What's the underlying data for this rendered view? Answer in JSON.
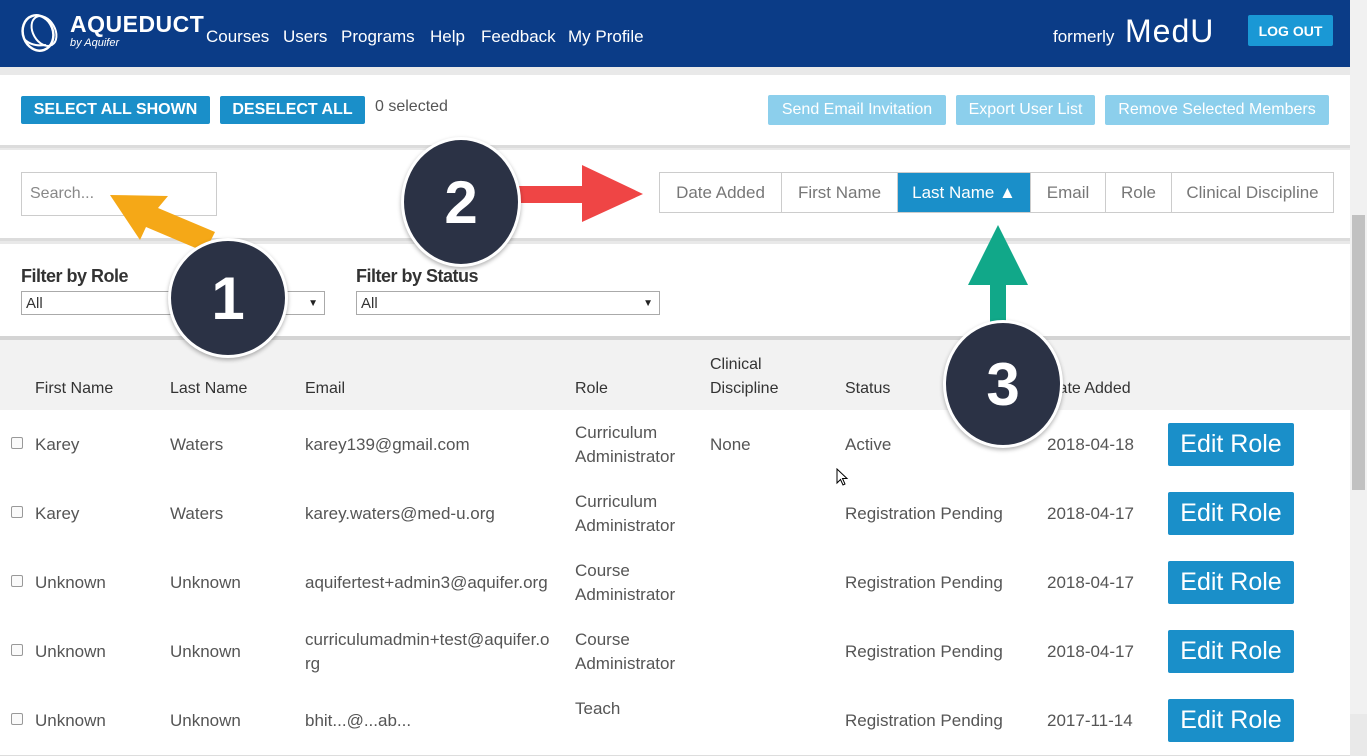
{
  "header": {
    "logo_title": "AQUEDUCT",
    "logo_subtitle": "by Aquifer",
    "nav": [
      "Courses",
      "Users",
      "Programs",
      "Help",
      "Feedback",
      "My Profile"
    ],
    "formerly": "formerly",
    "brand": "MedU",
    "logout": "LOG OUT",
    "bg_color": "#0b3c87"
  },
  "actions": {
    "select_all": "SELECT ALL SHOWN",
    "deselect_all": "DESELECT ALL",
    "selected_count": "0 selected",
    "send_invite": "Send Email Invitation",
    "export": "Export User List",
    "remove": "Remove Selected Members"
  },
  "search": {
    "placeholder": "Search..."
  },
  "sort": {
    "options": [
      "Date Added",
      "First Name",
      "Last Name ▲",
      "Email",
      "Role",
      "Clinical Discipline"
    ],
    "active": "Last Name ▲"
  },
  "filters": {
    "role_label": "Filter by Role",
    "role_value": "All",
    "status_label": "Filter by Status",
    "status_value": "All"
  },
  "table": {
    "headers": {
      "first_name": "First Name",
      "last_name": "Last Name",
      "email": "Email",
      "role": "Role",
      "clinical_1": "Clinical",
      "clinical_2": "Discipline",
      "status": "Status",
      "date_added": "Date Added"
    },
    "rows": [
      {
        "first": "Karey",
        "last": "Waters",
        "email": "karey139@gmail.com",
        "email2": "",
        "role1": "Curriculum",
        "role2": "Administrator",
        "discipline": "None",
        "status": "Active",
        "date": "2018-04-18",
        "action": "Edit Role"
      },
      {
        "first": "Karey",
        "last": "Waters",
        "email": "karey.waters@med-u.org",
        "email2": "",
        "role1": "Curriculum",
        "role2": "Administrator",
        "discipline": "",
        "status": "Registration Pending",
        "date": "2018-04-17",
        "action": "Edit Role"
      },
      {
        "first": "Unknown",
        "last": "Unknown",
        "email": "aquifertest+admin3@aquifer.org",
        "email2": "",
        "role1": "Course",
        "role2": "Administrator",
        "discipline": "",
        "status": "Registration Pending",
        "date": "2018-04-17",
        "action": "Edit Role"
      },
      {
        "first": "Unknown",
        "last": "Unknown",
        "email": "curriculumadmin+test@aquifer.o",
        "email2": "rg",
        "role1": "Course",
        "role2": "Administrator",
        "discipline": "",
        "status": "Registration Pending",
        "date": "2018-04-17",
        "action": "Edit Role"
      },
      {
        "first": "Unknown",
        "last": "Unknown",
        "email": "bhit...@...ab...",
        "email2": "",
        "role1": "Teach",
        "role2": "",
        "discipline": "",
        "status": "Registration Pending",
        "date": "2017-11-14",
        "action": "Edit Role"
      }
    ]
  },
  "annotations": {
    "badges": [
      "1",
      "2",
      "3"
    ],
    "arrow_colors": {
      "badge_1": "#f5a817",
      "badge_2": "#ef4545",
      "badge_3": "#11a889"
    }
  }
}
